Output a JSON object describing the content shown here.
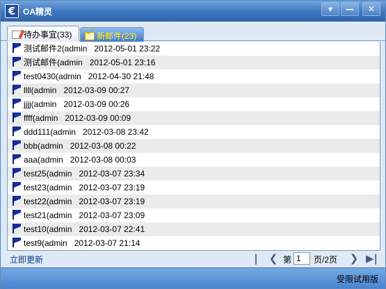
{
  "window": {
    "icon_glyph": "€",
    "title": "OA精灵",
    "controls": {
      "dropdown": "▾",
      "minimize": "—",
      "close": "✕"
    }
  },
  "tabs": [
    {
      "label": "待办事宜(33)",
      "icon": "note-icon"
    },
    {
      "label": "新邮件(23)",
      "icon": "mail-icon",
      "active": true
    }
  ],
  "mails": [
    {
      "subject": "测试邮件2",
      "sender": "(admin",
      "time": "2012-05-01 23:22"
    },
    {
      "subject": "测试邮件",
      "sender": "(admin",
      "time": "2012-05-01 23:16"
    },
    {
      "subject": "test0430",
      "sender": "(admin",
      "time": "2012-04-30 21:48"
    },
    {
      "subject": "llll",
      "sender": "(admin",
      "time": "2012-03-09 00:27"
    },
    {
      "subject": "jjjj",
      "sender": "(admin",
      "time": "2012-03-09 00:26"
    },
    {
      "subject": "ffff",
      "sender": "(admin",
      "time": "2012-03-09 00:09"
    },
    {
      "subject": "ddd111",
      "sender": "(admin",
      "time": "2012-03-08 23:42"
    },
    {
      "subject": "bbb",
      "sender": "(admin",
      "time": "2012-03-08 00:22"
    },
    {
      "subject": "aaa",
      "sender": "(admin",
      "time": "2012-03-08 00:03"
    },
    {
      "subject": "test25",
      "sender": "(admin",
      "time": "2012-03-07 23:34"
    },
    {
      "subject": "test23",
      "sender": "(admin",
      "time": "2012-03-07 23:19"
    },
    {
      "subject": "test22",
      "sender": "(admin",
      "time": "2012-03-07 23:19"
    },
    {
      "subject": "test21",
      "sender": "(admin",
      "time": "2012-03-07 23:09"
    },
    {
      "subject": "test10",
      "sender": "(admin",
      "time": "2012-03-07 22:41"
    },
    {
      "subject": "test9",
      "sender": "(admin",
      "time": "2012-03-07 21:14"
    }
  ],
  "pager": {
    "refresh_label": "立即更新",
    "first": "|◀",
    "prev": "❮",
    "page_prefix": "第",
    "current_page": "1",
    "page_suffix": "页/2页",
    "next": "❯",
    "last": "▶|"
  },
  "status": {
    "text": "受限试用版"
  }
}
